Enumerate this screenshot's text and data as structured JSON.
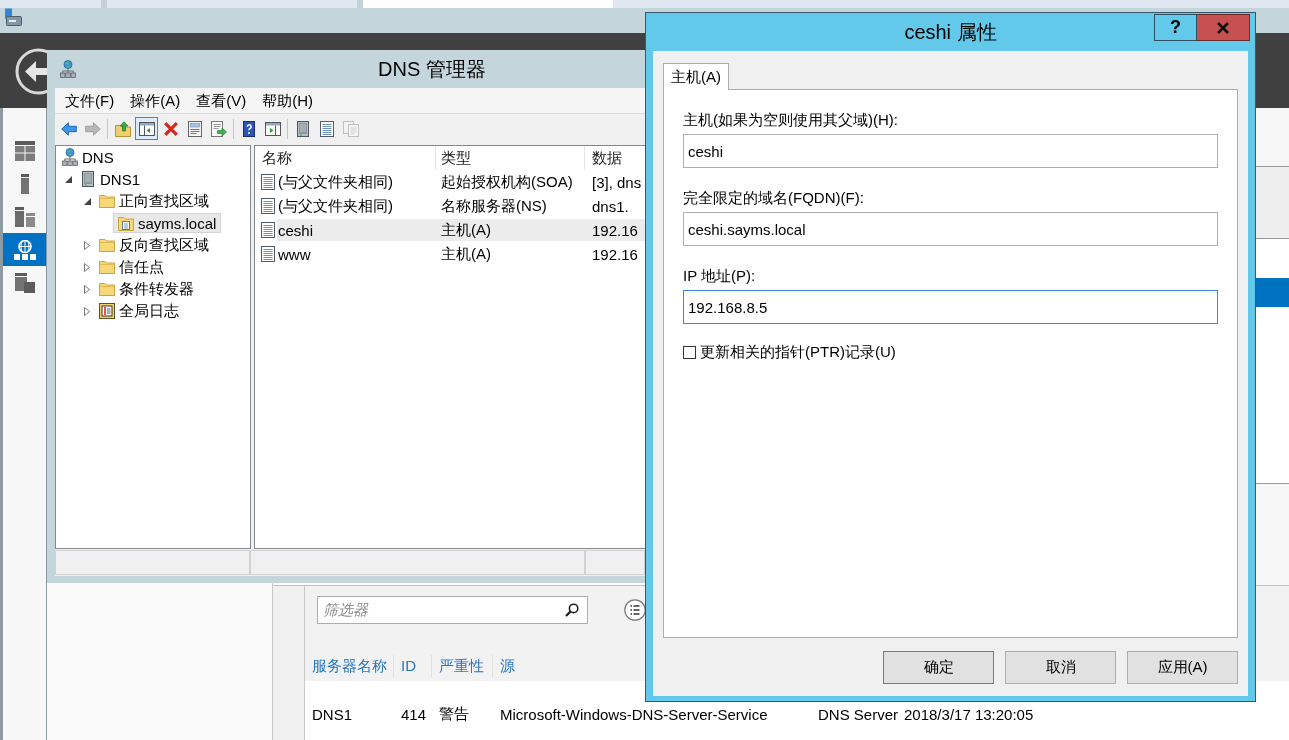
{
  "server_manager": {
    "nav_items": [
      {
        "kind": "dashboard",
        "selected": false
      },
      {
        "kind": "local-server",
        "selected": false
      },
      {
        "kind": "all-servers",
        "selected": false
      },
      {
        "kind": "dns",
        "selected": true
      },
      {
        "kind": "file-services",
        "selected": false
      }
    ],
    "events": {
      "filter_placeholder": "筛选器",
      "columns": [
        "服务器名称",
        "ID",
        "严重性",
        "源"
      ],
      "rows": [
        {
          "cells": [
            "DNS1",
            "414",
            "警告",
            "Microsoft-Windows-DNS-Server-Service",
            "DNS Server",
            "2018/3/17 13:20:05"
          ]
        }
      ]
    }
  },
  "dns_manager": {
    "title": "DNS 管理器",
    "menu": [
      "文件(F)",
      "操作(A)",
      "查看(V)",
      "帮助(H)"
    ],
    "toolbar": [
      [
        {
          "kind": "back",
          "disabled": false,
          "pressed": false
        },
        {
          "kind": "forward",
          "disabled": true,
          "pressed": false
        }
      ],
      [
        {
          "kind": "up",
          "disabled": false,
          "pressed": false
        },
        {
          "kind": "show-tree",
          "disabled": false,
          "pressed": true
        },
        {
          "kind": "delete",
          "disabled": false,
          "pressed": false
        },
        {
          "kind": "properties",
          "disabled": false,
          "pressed": false
        },
        {
          "kind": "export",
          "disabled": false,
          "pressed": false
        }
      ],
      [
        {
          "kind": "help",
          "disabled": false,
          "pressed": false
        },
        {
          "kind": "action-pane",
          "disabled": false,
          "pressed": false
        }
      ],
      [
        {
          "kind": "server",
          "disabled": false,
          "pressed": false
        },
        {
          "kind": "document",
          "disabled": false,
          "pressed": false
        },
        {
          "kind": "copy",
          "disabled": true,
          "pressed": false
        }
      ]
    ],
    "tree": [
      {
        "label": "DNS",
        "kind": "root",
        "selected": false,
        "children": [
          {
            "label": "DNS1",
            "kind": "server",
            "selected": false,
            "expanded": true,
            "children": [
              {
                "label": "正向查找区域",
                "kind": "folder",
                "selected": false,
                "expanded": true,
                "children": [
                  {
                    "label": "sayms.local",
                    "kind": "zone",
                    "selected": true
                  }
                ]
              },
              {
                "label": "反向查找区域",
                "kind": "folder",
                "selected": false,
                "expanded": false
              },
              {
                "label": "信任点",
                "kind": "folder",
                "selected": false,
                "expanded": false
              },
              {
                "label": "条件转发器",
                "kind": "folder",
                "selected": false,
                "expanded": false
              },
              {
                "label": "全局日志",
                "kind": "log",
                "selected": false,
                "expanded": false
              }
            ]
          }
        ]
      }
    ],
    "list": {
      "columns": [
        "名称",
        "类型",
        "数据"
      ],
      "rows": [
        {
          "cells": [
            "(与父文件夹相同)",
            "起始授权机构(SOA)",
            "[3], dns"
          ],
          "selected": false
        },
        {
          "cells": [
            "(与父文件夹相同)",
            "名称服务器(NS)",
            "dns1."
          ],
          "selected": false
        },
        {
          "cells": [
            "ceshi",
            "主机(A)",
            "192.16"
          ],
          "selected": true
        },
        {
          "cells": [
            "www",
            "主机(A)",
            "192.16"
          ],
          "selected": false
        }
      ]
    }
  },
  "dialog": {
    "title": "ceshi 属性",
    "help_button": "?",
    "tabs": [
      {
        "label": "主机(A)",
        "selected": true
      }
    ],
    "fields": [
      {
        "label": "主机(如果为空则使用其父域)(H):",
        "value": "ceshi",
        "focused": false
      },
      {
        "label": "完全限定的域名(FQDN)(F):",
        "value": "ceshi.sayms.local",
        "focused": false
      },
      {
        "label": "IP 地址(P):",
        "value": "192.168.8.5",
        "focused": true
      }
    ],
    "checkbox": {
      "label": "更新相关的指针(PTR)记录(U)",
      "checked": false
    },
    "buttons": [
      {
        "label": "确定",
        "default": true
      },
      {
        "label": "取消",
        "default": false
      },
      {
        "label": "应用(A)",
        "default": false
      }
    ]
  }
}
